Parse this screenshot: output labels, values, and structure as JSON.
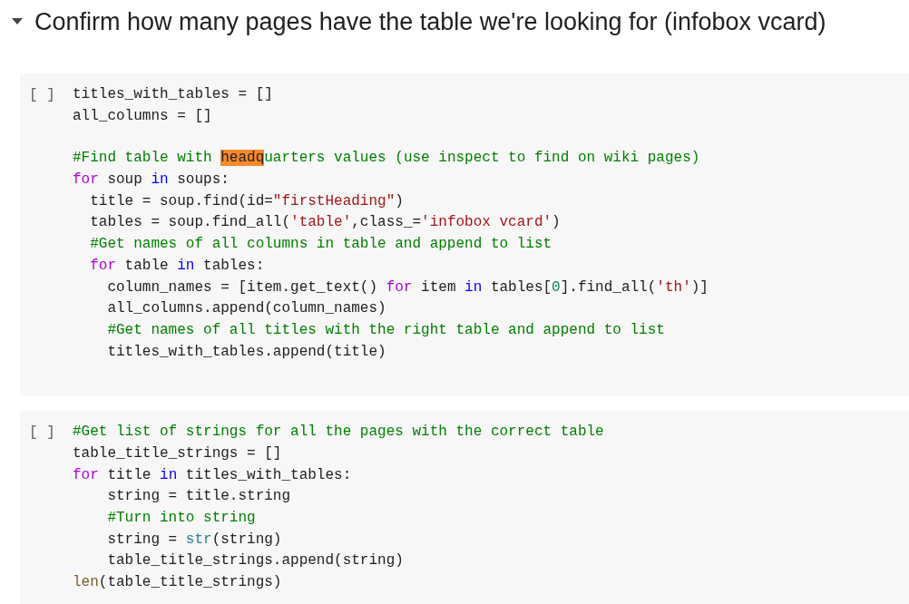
{
  "section": {
    "title": "Confirm how many pages have the table we're looking for (infobox vcard)",
    "expanded": true
  },
  "cells": [
    {
      "run_indicator": "[ ]",
      "blocks": [
        {
          "lines": [
            {
              "tokens": [
                {
                  "kind": "plain",
                  "text": "titles_with_tables = []"
                }
              ]
            },
            {
              "tokens": [
                {
                  "kind": "plain",
                  "text": "all_columns = []"
                }
              ]
            }
          ]
        },
        {
          "lines": [
            {
              "tokens": [
                {
                  "kind": "comment",
                  "text": "#Find table with "
                },
                {
                  "kind": "match",
                  "text": "headq"
                },
                {
                  "kind": "comment",
                  "text": "uarters values (use inspect to find on wiki pages)"
                }
              ]
            },
            {
              "tokens": [
                {
                  "kind": "keyword",
                  "text": "for"
                },
                {
                  "kind": "plain",
                  "text": " soup "
                },
                {
                  "kind": "operator",
                  "text": "in"
                },
                {
                  "kind": "plain",
                  "text": " soups:"
                }
              ]
            },
            {
              "tokens": [
                {
                  "kind": "plain",
                  "text": "  title = soup.find(id="
                },
                {
                  "kind": "string",
                  "text": "\"firstHeading\""
                },
                {
                  "kind": "plain",
                  "text": ")"
                }
              ]
            },
            {
              "tokens": [
                {
                  "kind": "plain",
                  "text": "  tables = soup.find_all("
                },
                {
                  "kind": "string",
                  "text": "'table'"
                },
                {
                  "kind": "plain",
                  "text": ",class_="
                },
                {
                  "kind": "string",
                  "text": "'infobox vcard'"
                },
                {
                  "kind": "plain",
                  "text": ")"
                }
              ]
            },
            {
              "tokens": [
                {
                  "kind": "comment",
                  "text": "  #Get names of all columns in table and append to list"
                }
              ]
            },
            {
              "tokens": [
                {
                  "kind": "keyword",
                  "text": "  for"
                },
                {
                  "kind": "plain",
                  "text": " table "
                },
                {
                  "kind": "operator",
                  "text": "in"
                },
                {
                  "kind": "plain",
                  "text": " tables:"
                }
              ]
            },
            {
              "tokens": [
                {
                  "kind": "plain",
                  "text": "    column_names = [item.get_text() "
                },
                {
                  "kind": "keyword",
                  "text": "for"
                },
                {
                  "kind": "plain",
                  "text": " item "
                },
                {
                  "kind": "operator",
                  "text": "in"
                },
                {
                  "kind": "plain",
                  "text": " tables["
                },
                {
                  "kind": "number",
                  "text": "0"
                },
                {
                  "kind": "plain",
                  "text": "].find_all("
                },
                {
                  "kind": "string",
                  "text": "'th'"
                },
                {
                  "kind": "plain",
                  "text": ")]"
                }
              ]
            },
            {
              "tokens": [
                {
                  "kind": "plain",
                  "text": "    all_columns.append(column_names)"
                }
              ]
            },
            {
              "tokens": [
                {
                  "kind": "comment",
                  "text": "    #Get names of all titles with the right table and append to list"
                }
              ]
            },
            {
              "tokens": [
                {
                  "kind": "plain",
                  "text": "    titles_with_tables.append(title)"
                }
              ]
            }
          ]
        }
      ]
    },
    {
      "run_indicator": "[ ]",
      "blocks": [
        {
          "lines": [
            {
              "tokens": [
                {
                  "kind": "comment",
                  "text": "#Get list of strings for all the pages with the correct table"
                }
              ]
            },
            {
              "tokens": [
                {
                  "kind": "plain",
                  "text": "table_title_strings = []"
                }
              ]
            },
            {
              "tokens": [
                {
                  "kind": "keyword",
                  "text": "for"
                },
                {
                  "kind": "plain",
                  "text": " title "
                },
                {
                  "kind": "operator",
                  "text": "in"
                },
                {
                  "kind": "plain",
                  "text": " titles_with_tables:"
                }
              ]
            },
            {
              "tokens": [
                {
                  "kind": "plain",
                  "text": "    string = title.string"
                }
              ]
            },
            {
              "tokens": [
                {
                  "kind": "comment",
                  "text": "    #Turn into string"
                }
              ]
            },
            {
              "tokens": [
                {
                  "kind": "plain",
                  "text": "    string = "
                },
                {
                  "kind": "builtin",
                  "text": "str"
                },
                {
                  "kind": "plain",
                  "text": "(string)"
                }
              ]
            },
            {
              "tokens": [
                {
                  "kind": "plain",
                  "text": "    table_title_strings.append(string)"
                }
              ]
            },
            {
              "tokens": [
                {
                  "kind": "function",
                  "text": "len"
                },
                {
                  "kind": "plain",
                  "text": "(table_title_strings)"
                }
              ]
            }
          ]
        }
      ]
    }
  ]
}
